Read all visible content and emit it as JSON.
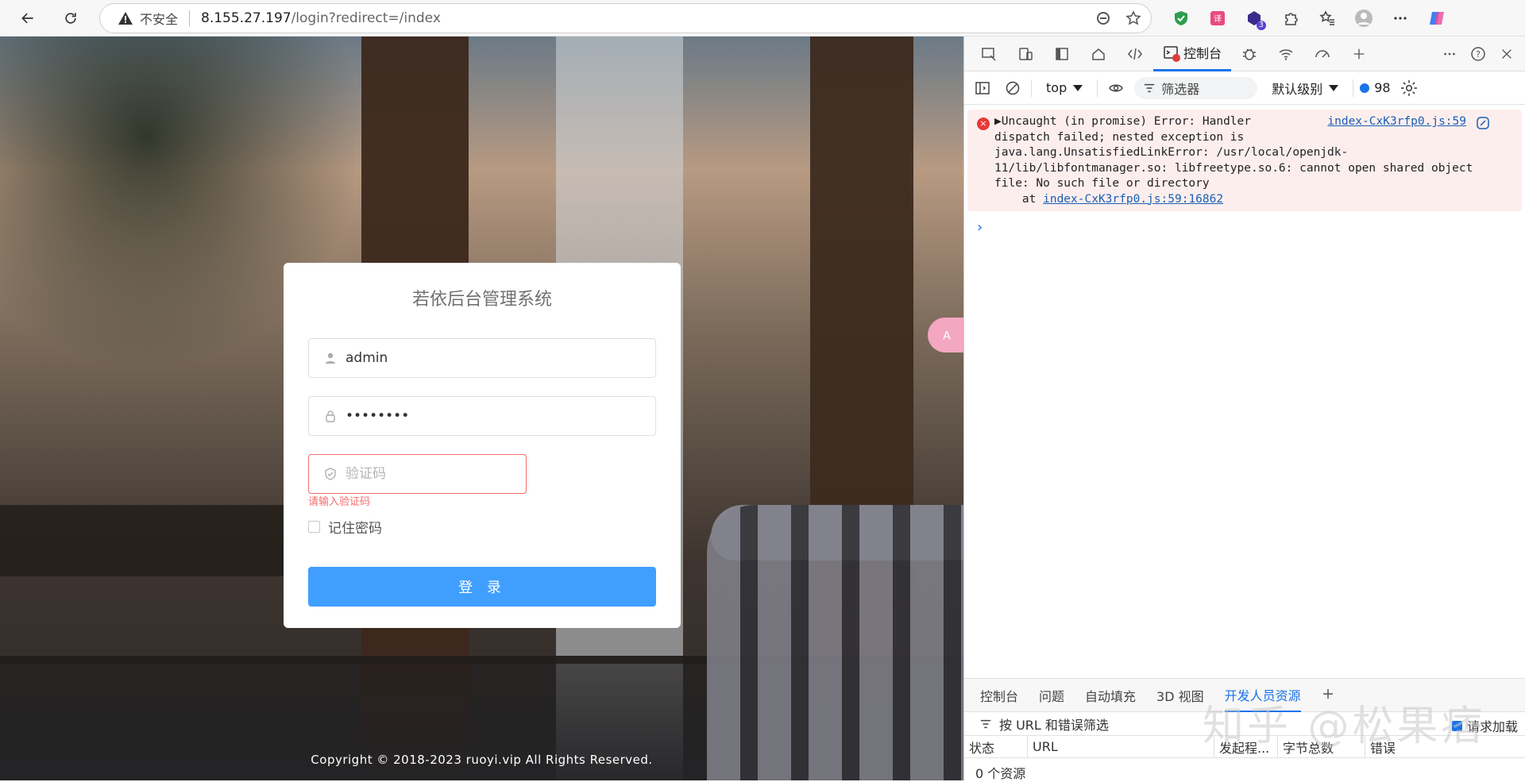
{
  "browser": {
    "insecure_label": "不安全",
    "url_host": "8.155.27.197",
    "url_path": "/login?redirect=/index",
    "ext_badge_count": "3"
  },
  "login": {
    "title": "若依后台管理系统",
    "username_value": "admin",
    "password_value": "••••••••",
    "captcha_placeholder": "验证码",
    "captcha_error": "请输入验证码",
    "remember_label": "记住密码",
    "submit_label": "登 录"
  },
  "footer": {
    "copyright": "Copyright © 2018-2023 ruoyi.vip All Rights Reserved."
  },
  "devtools": {
    "active_tab_label": "控制台",
    "context_select": "top",
    "filter_label": "筛选器",
    "level_select": "默认级别",
    "message_count": "98",
    "error": {
      "lines": [
        "▶Uncaught (in promise) Error: Handler",
        "dispatch failed; nested exception is",
        "java.lang.UnsatisfiedLinkError: /usr/local/openjdk-",
        "11/lib/libfontmanager.so: libfreetype.so.6: cannot open shared object",
        "file: No such file or directory"
      ],
      "stack_prefix": "    at ",
      "stack_link": "index-CxK3rfp0.js:59:16862",
      "source_link": "index-CxK3rfp0.js:59"
    },
    "drawer": {
      "tabs": [
        "控制台",
        "问题",
        "自动填充",
        "3D 视图",
        "开发人员资源"
      ],
      "active_tab": "开发人员资源",
      "filter_placeholder": "按 URL 和错误筛选",
      "load_option": "请求加载",
      "columns": [
        "状态",
        "URL",
        "发起程...",
        "字节总数",
        "错误"
      ],
      "resource_count": "0 个资源"
    }
  },
  "watermark": "知乎 @松果痞"
}
